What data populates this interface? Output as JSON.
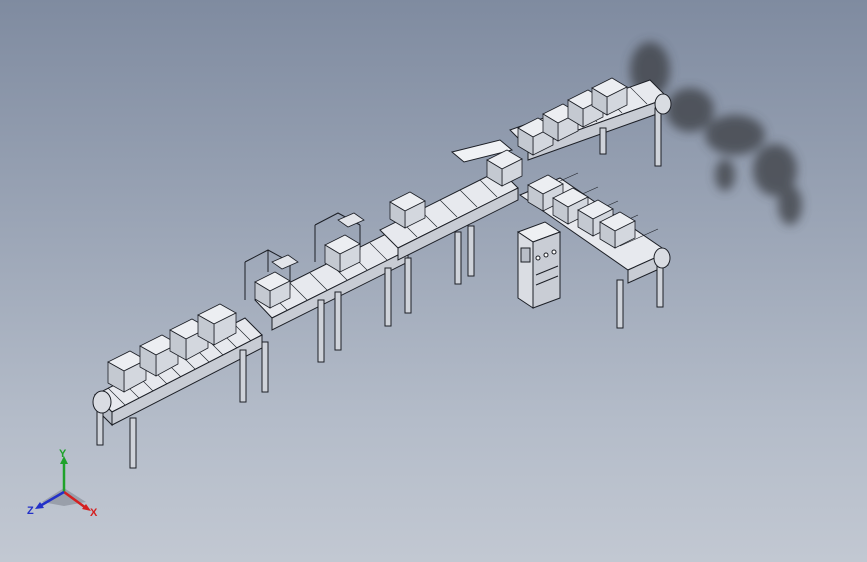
{
  "viewport": {
    "background_top": "#7f8ba0",
    "background_bottom": "#c2c8d2",
    "model_line_color": "#1c1f26",
    "model_face_color": "#dfe2e8"
  },
  "triad": {
    "x_label": "X",
    "y_label": "Y",
    "z_label": "Z",
    "x_color": "#d42020",
    "y_color": "#1fa22a",
    "z_color": "#2230c8"
  }
}
